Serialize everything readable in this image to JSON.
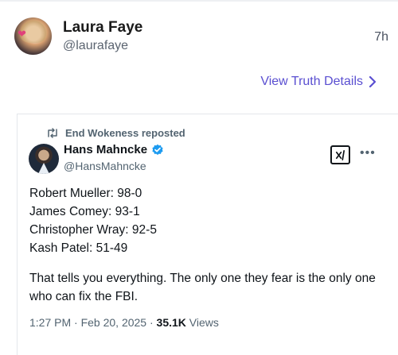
{
  "post": {
    "author_name": "Laura Faye",
    "author_handle": "@laurafaye",
    "time": "7h",
    "details_link": "View Truth Details"
  },
  "embed": {
    "repost_label": "End Wokeness reposted",
    "author_name": "Hans Mahncke",
    "author_handle": "@HansMahncke",
    "lines": [
      "Robert Mueller: 98-0",
      "James Comey: 93-1",
      "Christopher Wray: 92-5",
      "Kash Patel: 51-49"
    ],
    "paragraph": "That tells you everything. The only one they fear is the only one who can fix the FBI.",
    "meta_date": "1:27 PM · Feb 20, 2025 · ",
    "meta_views_count": "35.1K",
    "meta_views_label": " Views"
  },
  "colors": {
    "link": "#5a4fd1",
    "verified": "#1d9bf0"
  },
  "icons": [
    "repost-icon",
    "verified-icon",
    "grok-icon",
    "more-icon",
    "chevron-right-icon"
  ]
}
